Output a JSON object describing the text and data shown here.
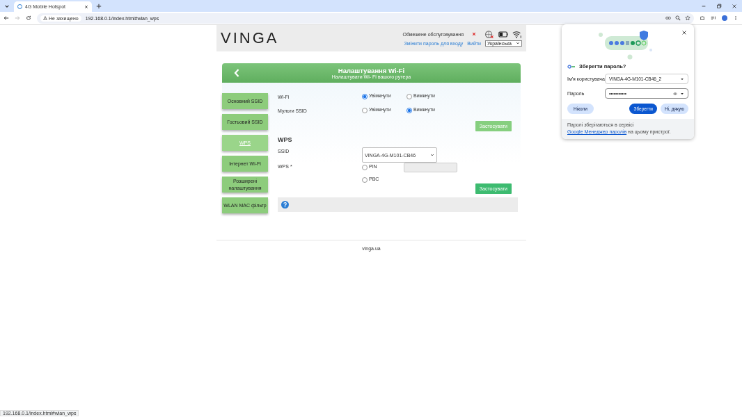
{
  "browser": {
    "tab_title": "4G Mobile Hotspot",
    "security": "Не захищено",
    "url": "192.168.0.1/index.html#wlan_wps",
    "status_url": "192.168.0.1/index.html#wlan_wps"
  },
  "header": {
    "logo": "VINGA",
    "status": "Обмежене обслуговування",
    "links": [
      "Змінити пароль для входу",
      "Вийти"
    ],
    "language": "Українська"
  },
  "banner": {
    "title": "Налаштування Wi-Fi",
    "subtitle": "Налаштувати Wi- Fi вашого рутера"
  },
  "sidebar": {
    "items": [
      {
        "label": "Основний SSID",
        "selected": false
      },
      {
        "label": "Гостьовий SSID",
        "selected": false
      },
      {
        "label": "WPS",
        "selected": true
      },
      {
        "label": "Інтернет Wi-Fi",
        "selected": false
      },
      {
        "label": "Розширені налаштування",
        "selected": false
      },
      {
        "label": "WLAN MAC фільтр",
        "selected": false
      }
    ]
  },
  "wifi_settings": {
    "rows": [
      {
        "label": "Wi-Fi",
        "options": [
          {
            "label": "Увімкнути",
            "selected": true
          },
          {
            "label": "Вимкнути",
            "selected": false
          }
        ]
      },
      {
        "label": "Мульти SSID",
        "options": [
          {
            "label": "Увімкнути",
            "selected": false
          },
          {
            "label": "Вимкнути",
            "selected": true
          }
        ]
      }
    ],
    "apply": {
      "label": "Застосувати",
      "disabled": true
    }
  },
  "wps": {
    "heading": "WPS",
    "ssid_label": "SSID",
    "ssid_value": "VINGA-4G-M101-CB46",
    "wps_label": "WPS *",
    "options": [
      {
        "label": "PIN",
        "selected": false,
        "kind": "with_input"
      },
      {
        "label": "PBC",
        "selected": false,
        "kind": "plain"
      }
    ],
    "apply": {
      "label": "Застосувати",
      "disabled": false
    }
  },
  "footer": "vinga.ua",
  "password_popup": {
    "title": "Зберегти пароль?",
    "username_label": "Ім'я користувача",
    "username": "VINGA-4G-M101-CB46_2",
    "password_label": "Пароль",
    "password": "•••••••••••",
    "buttons": [
      {
        "label": "Ніколи",
        "kind": "secondary"
      },
      {
        "label": "Зберегти",
        "kind": "primary"
      },
      {
        "label": "Ні, дякую",
        "kind": "secondary"
      }
    ],
    "note_before": "Паролі зберігаються в сервісі ",
    "note_link": "Google Менеджер паролів",
    "note_after": " на цьому пристрої."
  }
}
